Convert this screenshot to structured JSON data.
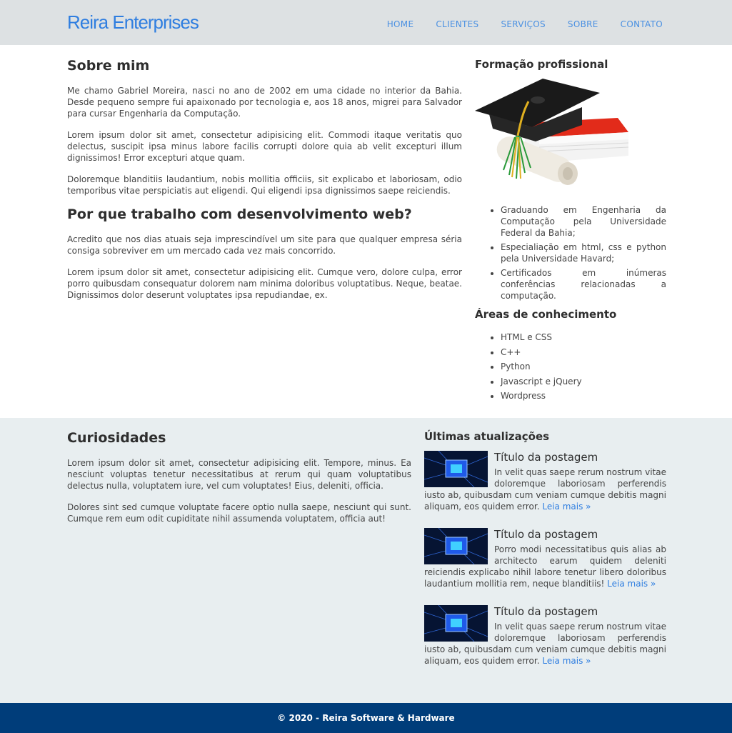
{
  "header": {
    "brand": "Reira Enterprises",
    "nav": [
      "HOME",
      "CLIENTES",
      "SERVIÇOS",
      "SOBRE",
      "CONTATO"
    ]
  },
  "about": {
    "title": "Sobre mim",
    "paragraphs": [
      "Me chamo Gabriel Moreira, nasci no ano de 2002 em uma cidade no interior da Bahia. Desde pequeno sempre fui apaixonado por tecnologia e, aos 18 anos, migrei para Salvador para cursar Engenharia da Computação.",
      "Lorem ipsum dolor sit amet, consectetur adipisicing elit. Commodi itaque veritatis quo delectus, suscipit ipsa minus labore facilis corrupti dolore quia ab velit excepturi illum dignissimos! Error excepturi atque quam.",
      "Doloremque blanditiis laudantium, nobis mollitia officiis, sit explicabo et laboriosam, odio temporibus vitae perspiciatis aut eligendi. Qui eligendi ipsa dignissimos saepe reiciendis."
    ]
  },
  "why": {
    "title": "Por que trabalho com desenvolvimento web?",
    "paragraphs": [
      "Acredito que nos dias atuais seja imprescindível um site para que qualquer empresa séria consiga sobreviver em um mercado cada vez mais concorrido.",
      "Lorem ipsum dolor sit amet, consectetur adipisicing elit. Cumque vero, dolore culpa, error porro quibusdam consequatur dolorem nam minima doloribus voluptatibus. Neque, beatae. Dignissimos dolor deserunt voluptates ipsa repudiandae, ex."
    ]
  },
  "formacao": {
    "title": "Formação profissional",
    "items": [
      "Graduando em Engenharia da Computação pela Universidade Federal da Bahia;",
      "Especialiação em html, css e python pela Universidade Havard;",
      "Certificados em inúmeras conferências relacionadas a computação."
    ]
  },
  "areas": {
    "title": "Áreas de conhecimento",
    "items": [
      "HTML e CSS",
      "C++",
      "Python",
      "Javascript e jQuery",
      "Wordpress"
    ]
  },
  "curiosidades": {
    "title": "Curiosidades",
    "paragraphs": [
      "Lorem ipsum dolor sit amet, consectetur adipisicing elit. Tempore, minus. Ea nesciunt voluptas tenetur necessitatibus at rerum qui quam voluptatibus delectus nulla, voluptatem iure, vel cum voluptates! Eius, deleniti, officia.",
      "Dolores sint sed cumque voluptate facere optio nulla saepe, nesciunt qui sunt. Cumque rem eum odit cupiditate nihil assumenda voluptatem, officia aut!"
    ]
  },
  "updates": {
    "title": "Últimas atualizações",
    "posts": [
      {
        "title": "Título da postagem",
        "text": "In velit quas saepe rerum nostrum vitae doloremque laboriosam perferendis iusto ab, quibusdam cum veniam cumque debitis magni aliquam, eos quidem error.",
        "link": "Leia mais »"
      },
      {
        "title": "Título da postagem",
        "text": "Porro modi necessitatibus quis alias ab architecto earum quidem deleniti reiciendis explicabo nihil labore tenetur libero doloribus laudantium mollitia rem, neque blanditiis!",
        "link": "Leia mais »"
      },
      {
        "title": "Título da postagem",
        "text": "In velit quas saepe rerum nostrum vitae doloremque laboriosam perferendis iusto ab, quibusdam cum veniam cumque debitis magni aliquam, eos quidem error.",
        "link": "Leia mais »"
      }
    ]
  },
  "footer": {
    "text": "© 2020 - Reira Software & Hardware"
  }
}
